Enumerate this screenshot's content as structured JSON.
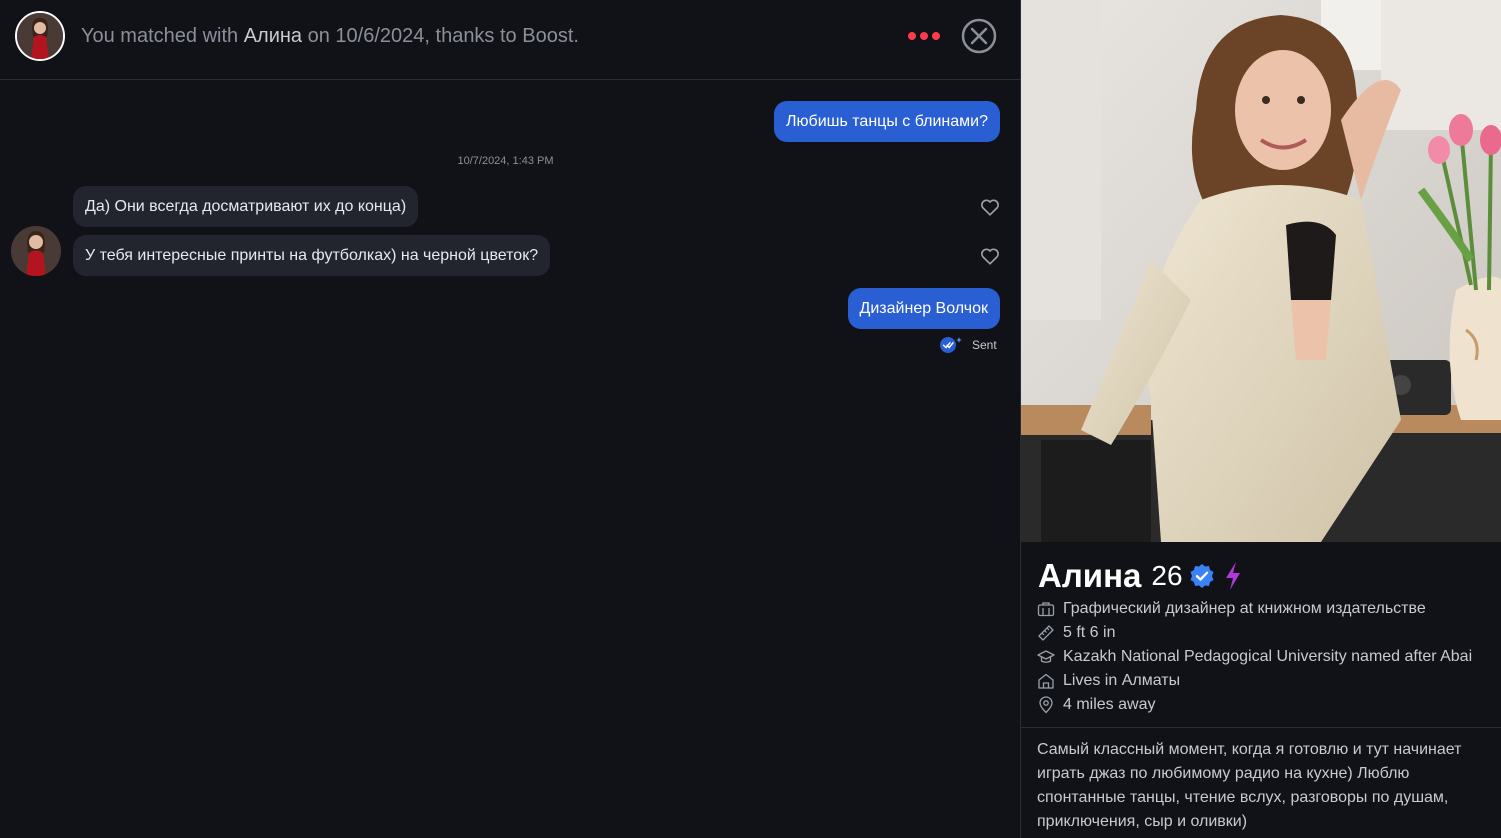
{
  "header": {
    "prefix": "You matched with ",
    "match_name": "Алина",
    "suffix": " on 10/6/2024, thanks to Boost.",
    "more_icon": "more-dots-icon",
    "close_icon": "close-circle-icon",
    "accent_color": "#fd3b4a"
  },
  "messages": [
    {
      "from": "me",
      "text": "Любишь танцы с блинами?"
    },
    {
      "type": "timestamp",
      "text": "10/7/2024, 1:43 PM"
    },
    {
      "from": "them",
      "text": "Да) Они всегда досматривают их до конца)"
    },
    {
      "from": "them",
      "text": "У тебя интересные принты на футболках) на черной цветок?"
    },
    {
      "from": "me",
      "text": "Дизайнер Волчок"
    }
  ],
  "status": {
    "label": "Sent",
    "icon": "read-receipt-icon"
  },
  "colors": {
    "outgoing_bubble": "#2a5fd3",
    "incoming_bubble": "#23252e",
    "verified": "#3b82f6",
    "boost": "#b03ad9"
  },
  "profile": {
    "name": "Алина",
    "age": "26",
    "job": "Графический дизайнер at книжном издательстве",
    "height": "5 ft 6 in",
    "school": "Kazakh National Pedagogical University named after Abai",
    "lives": "Lives in Алматы",
    "distance": "4 miles away",
    "bio": "Самый классный момент, когда я готовлю и тут начинает играть джаз по любимому радио на кухне) Люблю спонтанные танцы, чтение вслух, разговоры по душам, приключения, сыр и оливки)"
  }
}
